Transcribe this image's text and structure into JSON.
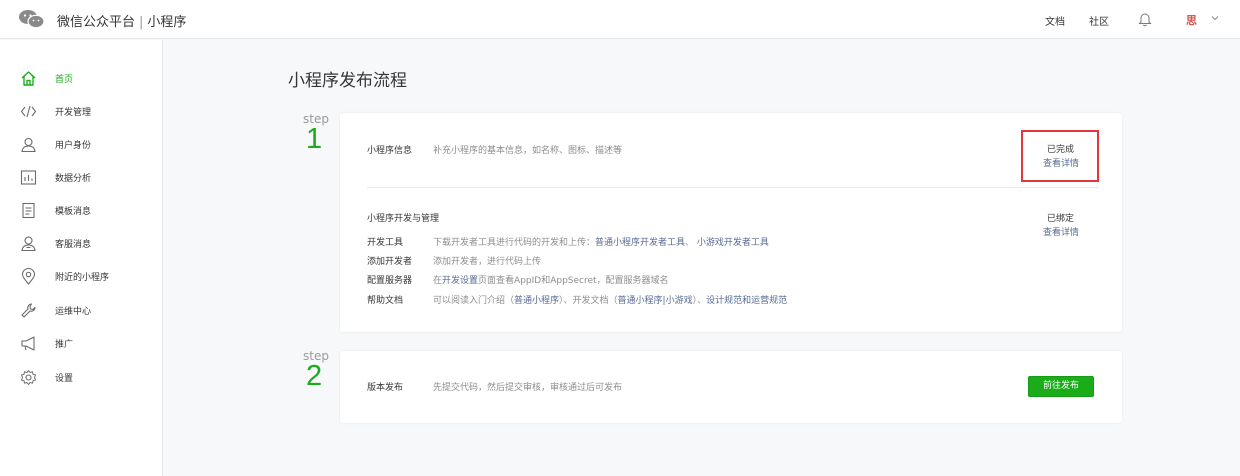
{
  "header": {
    "brand_name": "微信公众平台",
    "brand_sep": "|",
    "brand_product": "小程序",
    "links": {
      "docs": "文档",
      "community": "社区"
    },
    "avatar_text": "思"
  },
  "sidebar": {
    "items": [
      {
        "label": "首页",
        "icon": "home-icon",
        "active": true
      },
      {
        "label": "开发管理",
        "icon": "code-icon"
      },
      {
        "label": "用户身份",
        "icon": "user-icon"
      },
      {
        "label": "数据分析",
        "icon": "bar-chart-icon"
      },
      {
        "label": "模板消息",
        "icon": "document-icon"
      },
      {
        "label": "客服消息",
        "icon": "users-icon"
      },
      {
        "label": "附近的小程序",
        "icon": "location-pin-icon"
      },
      {
        "label": "运维中心",
        "icon": "wrench-icon"
      },
      {
        "label": "推广",
        "icon": "megaphone-icon"
      },
      {
        "label": "设置",
        "icon": "gear-icon"
      }
    ]
  },
  "main": {
    "title": "小程序发布流程",
    "step1": {
      "word": "step",
      "number": "1",
      "info": {
        "label": "小程序信息",
        "desc": "补充小程序的基本信息，如名称、图标、描述等",
        "status": "已完成",
        "link": "查看详情"
      },
      "dev": {
        "title": "小程序开发与管理",
        "status": "已绑定",
        "link": "查看详情",
        "rows": {
          "tools": {
            "label": "开发工具",
            "text": "下载开发者工具进行代码的开发和上传：",
            "link1": "普通小程序开发者工具",
            "mid": "、",
            "link2": "小游戏开发者工具"
          },
          "developers": {
            "label": "添加开发者",
            "text": "添加开发者，进行代码上传"
          },
          "server": {
            "label": "配置服务器",
            "pre": "在",
            "link": "开发设置",
            "post": "页面查看AppID和AppSecret，配置服务器域名"
          },
          "help": {
            "label": "帮助文档",
            "pre": "可以阅读入门介绍（",
            "link1": "普通小程序",
            "mid1": "）、开发文档（",
            "link2": "普通小程序|小游戏",
            "mid2": "）、",
            "link3": "设计规范和运营规范"
          }
        }
      }
    },
    "step2": {
      "word": "step",
      "number": "2",
      "label": "版本发布",
      "desc": "先提交代码，然后提交审核，审核通过后可发布",
      "button": "前往发布"
    }
  },
  "colors": {
    "accent_green": "#1aad19",
    "link_blue": "#576b95",
    "highlight_red": "#e0383e"
  }
}
